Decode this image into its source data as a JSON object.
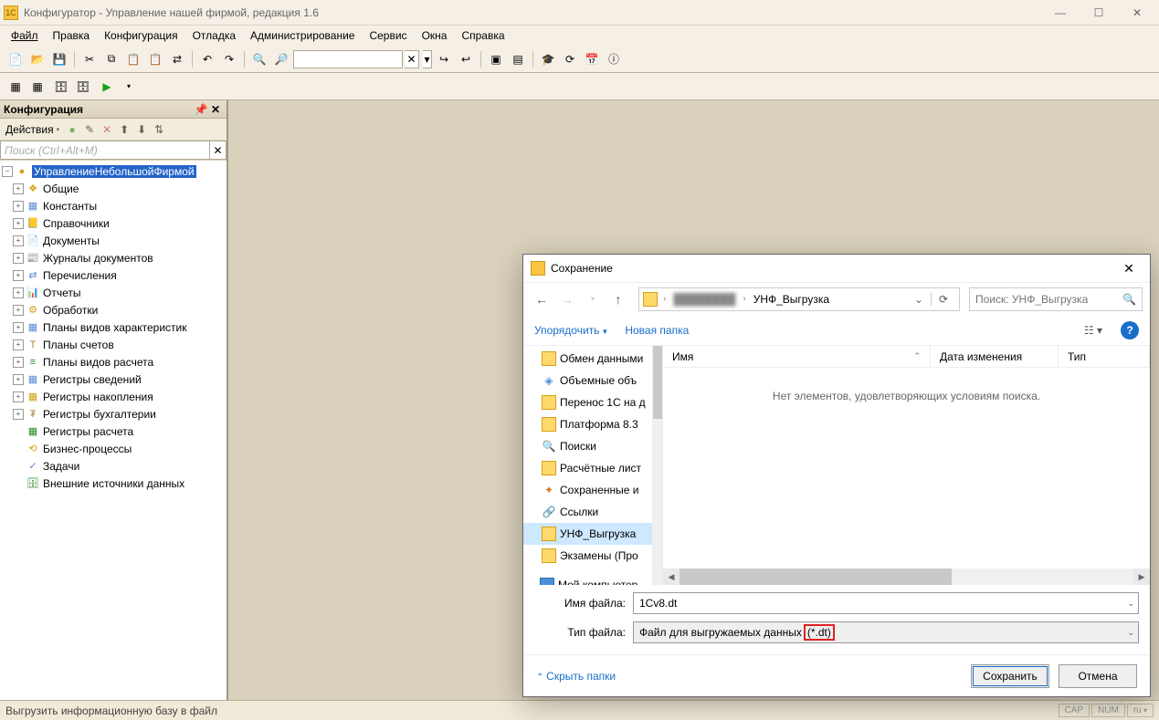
{
  "window": {
    "title": "Конфигуратор - Управление нашей фирмой, редакция 1.6"
  },
  "menu": {
    "file": "Файл",
    "edit": "Правка",
    "config": "Конфигурация",
    "debug": "Отладка",
    "admin": "Администрирование",
    "service": "Сервис",
    "windows": "Окна",
    "help": "Справка"
  },
  "sidebar": {
    "title": "Конфигурация",
    "actions_label": "Действия",
    "search_placeholder": "Поиск (Ctrl+Alt+M)",
    "root": "УправлениеНебольшойФирмой",
    "items": [
      "Общие",
      "Константы",
      "Справочники",
      "Документы",
      "Журналы документов",
      "Перечисления",
      "Отчеты",
      "Обработки",
      "Планы видов характеристик",
      "Планы счетов",
      "Планы видов расчета",
      "Регистры сведений",
      "Регистры накопления",
      "Регистры бухгалтерии",
      "Регистры расчета",
      "Бизнес-процессы",
      "Задачи",
      "Внешние источники данных"
    ]
  },
  "dialog": {
    "title": "Сохранение",
    "breadcrumb_current": "УНФ_Выгрузка",
    "search_placeholder": "Поиск: УНФ_Выгрузка",
    "toolbar": {
      "organize": "Упорядочить",
      "new_folder": "Новая папка"
    },
    "columns": {
      "name": "Имя",
      "date": "Дата изменения",
      "type": "Тип"
    },
    "empty_msg": "Нет элементов, удовлетворяющих условиям поиска.",
    "nav_items": [
      "Обмен данными",
      "Объемные объ",
      "Перенос 1С на д",
      "Платформа 8.3",
      "Поиски",
      "Расчётные лист",
      "Сохраненные и",
      "Ссылки",
      "УНФ_Выгрузка",
      "Экзамены (Про"
    ],
    "nav_computer": "Мой компьютер",
    "filename_label": "Имя файла:",
    "filetype_label": "Тип файла:",
    "filename_value": "1Cv8.dt",
    "filetype_prefix": "Файл для выгружаемых данных ",
    "filetype_ext": "(*.dt)",
    "hide_folders": "Скрыть папки",
    "save": "Сохранить",
    "cancel": "Отмена"
  },
  "status": {
    "message": "Выгрузить информационную базу в файл",
    "cap": "CAP",
    "num": "NUM",
    "lang": "ru"
  }
}
